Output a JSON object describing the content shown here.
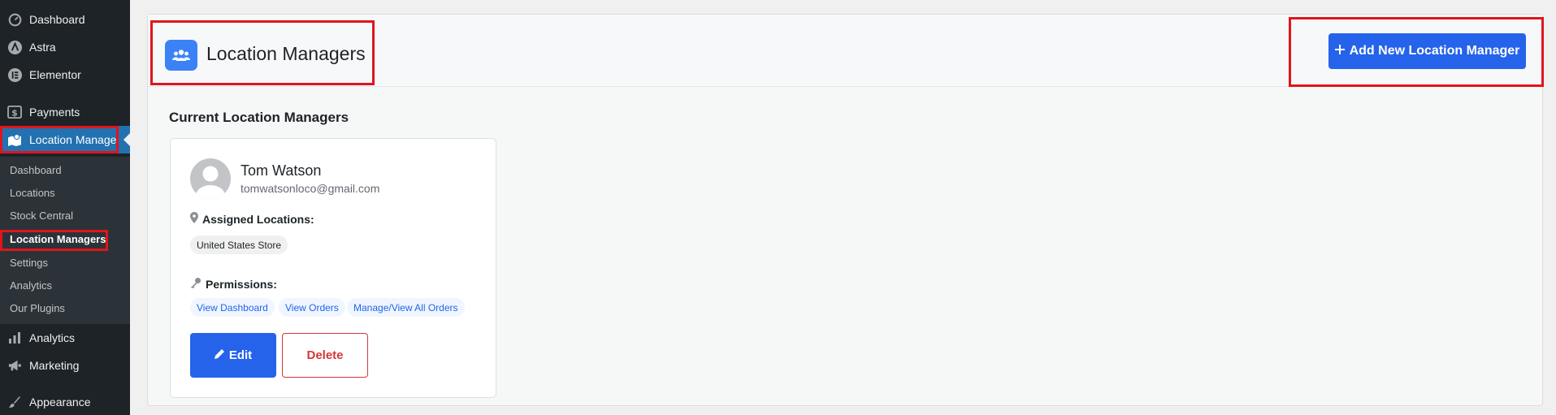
{
  "sidebar": {
    "menu": [
      {
        "label": "Dashboard",
        "icon": "dashboard-gauge-icon"
      },
      {
        "label": "Astra",
        "icon": "astra-logo-icon"
      },
      {
        "label": "Elementor",
        "icon": "elementor-logo-icon"
      },
      {
        "label": "Payments",
        "icon": "dollar-icon"
      },
      {
        "label": "Location Manage",
        "icon": "map-icon"
      },
      {
        "label": "Analytics",
        "icon": "bar-chart-icon"
      },
      {
        "label": "Marketing",
        "icon": "megaphone-icon"
      },
      {
        "label": "Appearance",
        "icon": "brush-icon"
      }
    ],
    "submenu": [
      {
        "label": "Dashboard"
      },
      {
        "label": "Locations"
      },
      {
        "label": "Stock Central"
      },
      {
        "label": "Location Managers"
      },
      {
        "label": "Settings"
      },
      {
        "label": "Analytics"
      },
      {
        "label": "Our Plugins"
      }
    ]
  },
  "header": {
    "title": "Location Managers",
    "add_button": "Add New Location Manager"
  },
  "section_title": "Current Location Managers",
  "manager": {
    "name": "Tom Watson",
    "email": "tomwatsonloco@gmail.com",
    "locations_label": "Assigned Locations:",
    "locations": [
      "United States Store"
    ],
    "permissions_label": "Permissions:",
    "permissions": [
      "View Dashboard",
      "View Orders",
      "Manage/View All Orders"
    ],
    "edit_label": "Edit",
    "delete_label": "Delete"
  },
  "colors": {
    "sidebar_bg": "#1d2327",
    "active_menu": "#2271b1",
    "primary": "#2563eb",
    "danger": "#d63638",
    "highlight": "#e0151c"
  }
}
